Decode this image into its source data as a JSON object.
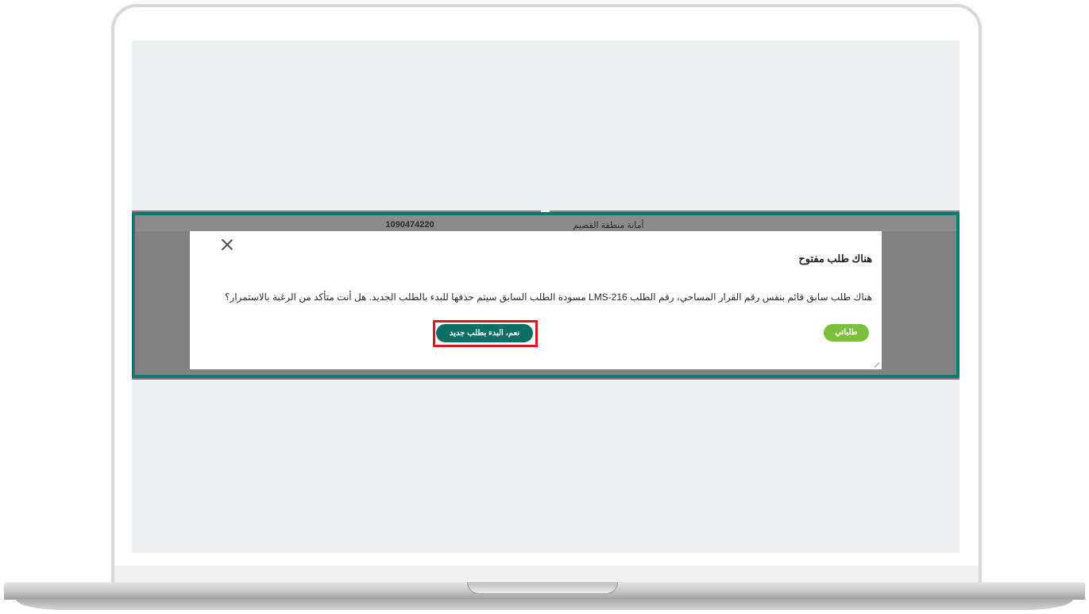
{
  "background_table": {
    "record_number": "1090474220",
    "entity_name": "أمانة منطقة القصيم"
  },
  "dialog": {
    "title": "هناك طلب مفتوح",
    "message": "هناك طلب سابق قائم بنفس رقم القرار المساحي، رقم الطلب   LMS-216 مسودة الطلب السابق سيتم حذفها للبدء بالطلب الجديد. هل أنت متأكد من الرغبة بالاستمرار؟",
    "close_icon": "close-icon",
    "confirm_button_label": "نعم، البدء بطلب جديد",
    "my_requests_button_label": "طلباتي"
  },
  "colors": {
    "highlight_border": "#0d7a70",
    "confirm_button": "#0b6f66",
    "my_requests_button": "#7cbf3c",
    "callout_frame": "#e3111b",
    "overlay": "#818181"
  }
}
